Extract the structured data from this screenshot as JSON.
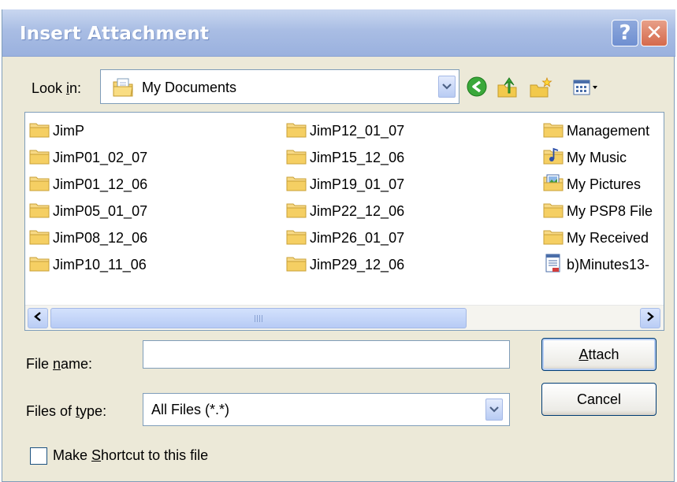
{
  "window": {
    "title": "Insert Attachment"
  },
  "titlebar": {
    "help_glyph": "?",
    "close_glyph": "✕"
  },
  "lookin": {
    "label_pre": "Look ",
    "label_key": "i",
    "label_post": "n:",
    "value": "My Documents",
    "icon": "documents-folder-icon"
  },
  "toolbar": {
    "icons": [
      "back-icon",
      "up-one-level-icon",
      "create-new-folder-icon",
      "view-menu-icon"
    ]
  },
  "files": {
    "columns": [
      [
        {
          "name": "JimP",
          "icon": "folder-icon"
        },
        {
          "name": "JimP01_02_07",
          "icon": "folder-icon"
        },
        {
          "name": "JimP01_12_06",
          "icon": "folder-icon"
        },
        {
          "name": "JimP05_01_07",
          "icon": "folder-icon"
        },
        {
          "name": "JimP08_12_06",
          "icon": "folder-icon"
        },
        {
          "name": "JimP10_11_06",
          "icon": "folder-icon"
        }
      ],
      [
        {
          "name": "JimP12_01_07",
          "icon": "folder-icon"
        },
        {
          "name": "JimP15_12_06",
          "icon": "folder-icon"
        },
        {
          "name": "JimP19_01_07",
          "icon": "folder-icon"
        },
        {
          "name": "JimP22_12_06",
          "icon": "folder-icon"
        },
        {
          "name": "JimP26_01_07",
          "icon": "folder-icon"
        },
        {
          "name": "JimP29_12_06",
          "icon": "folder-icon"
        }
      ],
      [
        {
          "name": "Management",
          "icon": "folder-icon"
        },
        {
          "name": "My Music",
          "icon": "music-folder-icon"
        },
        {
          "name": "My Pictures",
          "icon": "pictures-folder-icon"
        },
        {
          "name": "My PSP8 File",
          "icon": "folder-icon"
        },
        {
          "name": "My Received",
          "icon": "folder-icon"
        },
        {
          "name": "b)Minutes13-",
          "icon": "document-icon"
        }
      ]
    ]
  },
  "filename": {
    "label_pre": "File ",
    "label_key": "n",
    "label_post": "ame:",
    "value": ""
  },
  "filetype": {
    "label_pre": "Files of ",
    "label_key": "t",
    "label_post": "ype:",
    "value": "All Files (*.*)"
  },
  "buttons": {
    "attach_key": "A",
    "attach_rest": "ttach",
    "cancel": "Cancel"
  },
  "shortcut": {
    "label_pre": "Make ",
    "label_key": "S",
    "label_post": "hortcut to this file",
    "checked": false
  }
}
